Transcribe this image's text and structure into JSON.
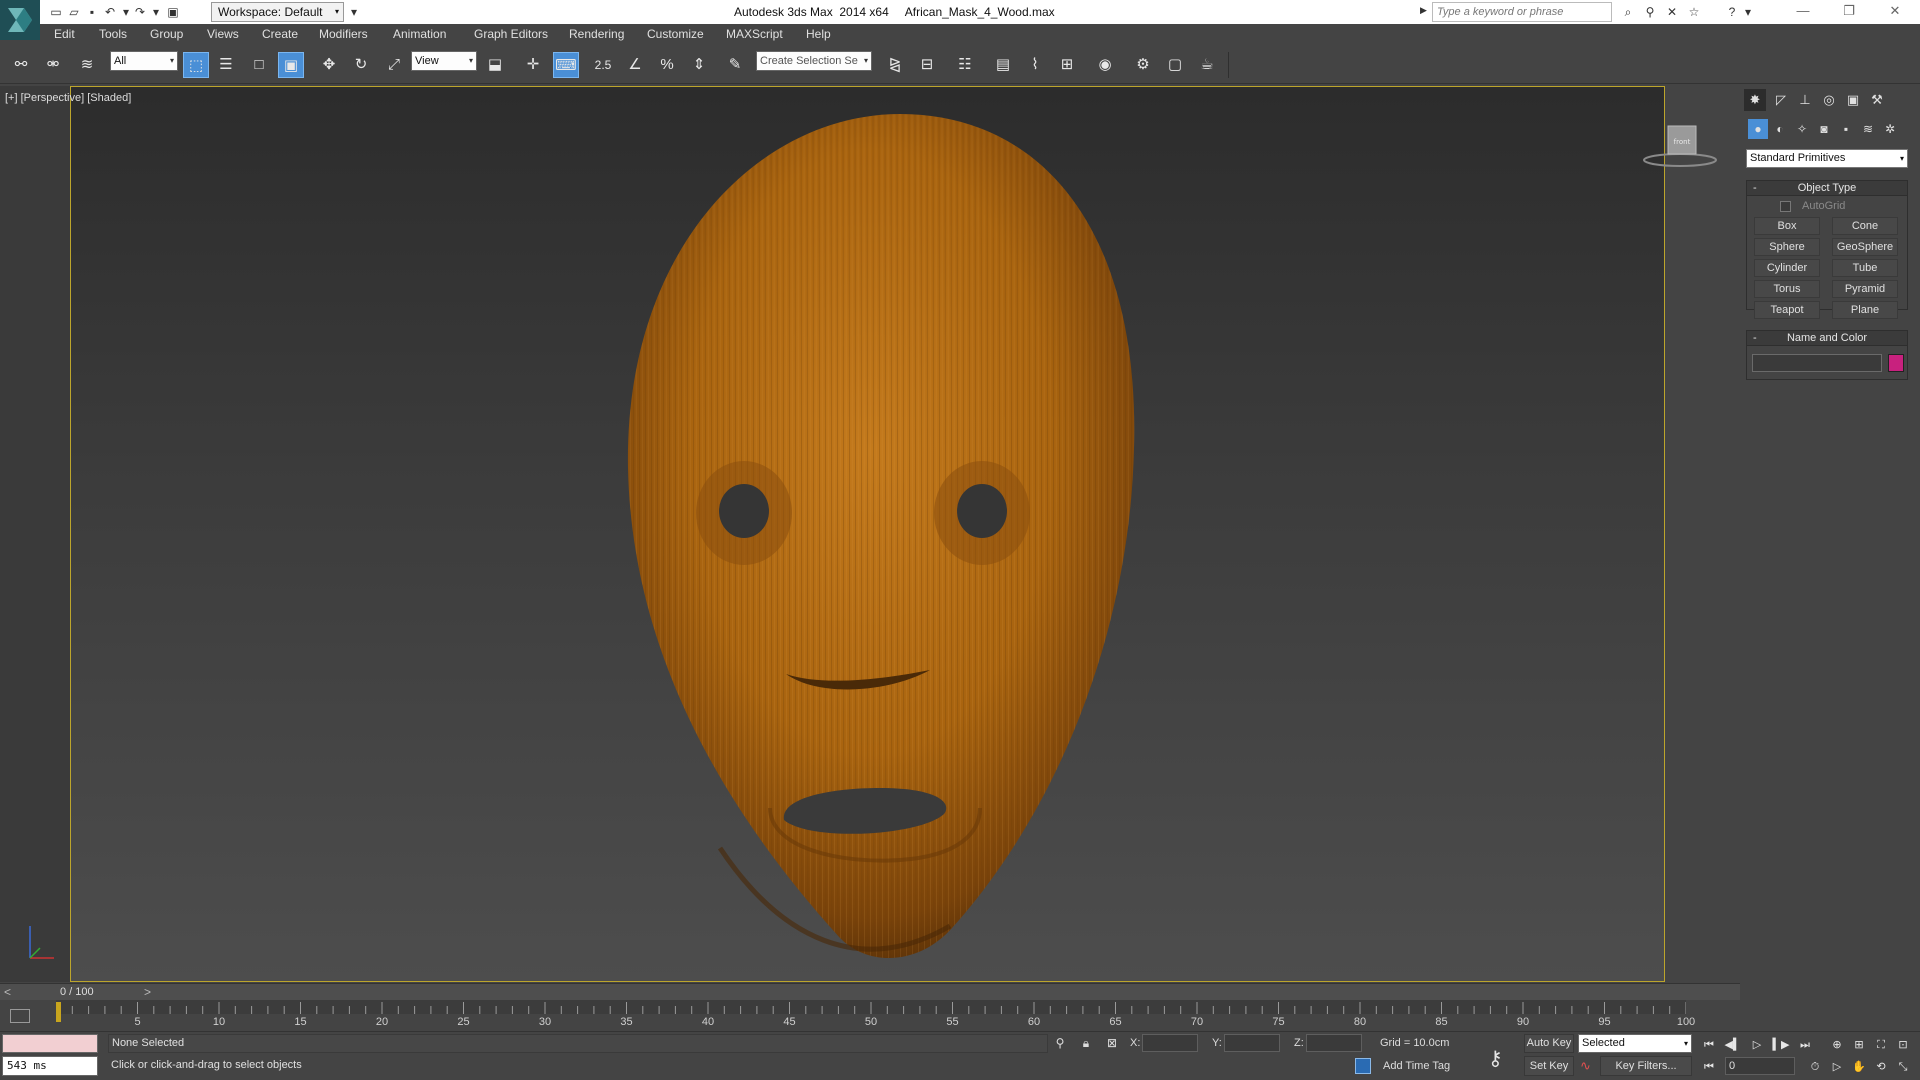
{
  "titlebar": {
    "workspace_label": "Workspace: Default",
    "title": "Autodesk 3ds Max  2014 x64     African_Mask_4_Wood.max",
    "search_placeholder": "Type a keyword or phrase"
  },
  "menu": {
    "items": [
      "Edit",
      "Tools",
      "Group",
      "Views",
      "Create",
      "Modifiers",
      "Animation",
      "Graph Editors",
      "Rendering",
      "Customize",
      "MAXScript",
      "Help"
    ]
  },
  "toolbar": {
    "selection_filter": "All",
    "ref_coord": "View",
    "snap_value": "2.5",
    "selection_set_placeholder": "Create Selection Se"
  },
  "viewport": {
    "label": "[+] [Perspective] [Shaded]",
    "viewcube_face": "front",
    "mask_wood_color": "#b86e16"
  },
  "command_panel": {
    "primitive_category": "Standard Primitives",
    "object_type_title": "Object Type",
    "autogrid_label": "AutoGrid",
    "buttons": [
      "Box",
      "Cone",
      "Sphere",
      "GeoSphere",
      "Cylinder",
      "Tube",
      "Torus",
      "Pyramid",
      "Teapot",
      "Plane"
    ],
    "name_color_title": "Name and Color",
    "object_color": "#c8217e"
  },
  "timeline": {
    "frame_display": "0 / 100",
    "ticks": [
      5,
      10,
      15,
      20,
      25,
      30,
      35,
      40,
      45,
      50,
      55,
      60,
      65,
      70,
      75,
      80,
      85,
      90,
      95,
      100
    ]
  },
  "status": {
    "timer": "543 ms",
    "selection": "None Selected",
    "prompt": "Click or click-and-drag to select objects",
    "x_label": "X:",
    "y_label": "Y:",
    "z_label": "Z:",
    "grid": "Grid = 10.0cm",
    "add_time_tag": "Add Time Tag",
    "auto_key": "Auto Key",
    "set_key": "Set Key",
    "key_mode": "Selected",
    "key_filters": "Key Filters...",
    "current_frame": "0"
  }
}
